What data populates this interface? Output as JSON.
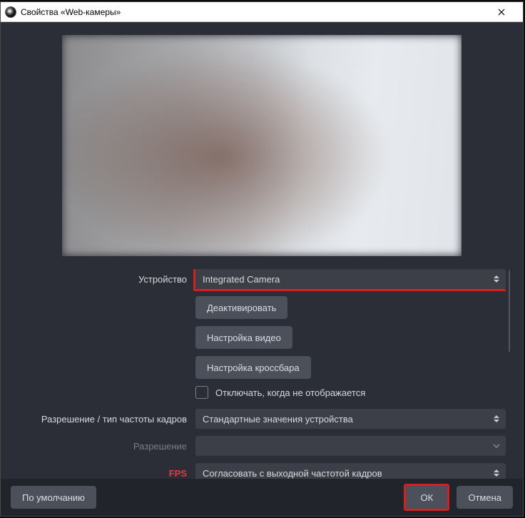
{
  "titlebar": {
    "title": "Свойства «Web-камеры»"
  },
  "form": {
    "device_label": "Устройство",
    "device_value": "Integrated Camera",
    "deactivate_btn": "Деактивировать",
    "video_settings_btn": "Настройка видео",
    "crossbar_settings_btn": "Настройка кроссбара",
    "hide_when_not_shown": "Отключать, когда не отображается",
    "resolution_type_label": "Разрешение / тип частоты кадров",
    "resolution_type_value": "Стандартные значения устройства",
    "resolution_label": "Разрешение",
    "resolution_value": "",
    "fps_label": "FPS",
    "fps_value": "Согласовать с выходной частотой кадров"
  },
  "footer": {
    "defaults": "По умолчанию",
    "ok": "ОК",
    "cancel": "Отмена"
  }
}
